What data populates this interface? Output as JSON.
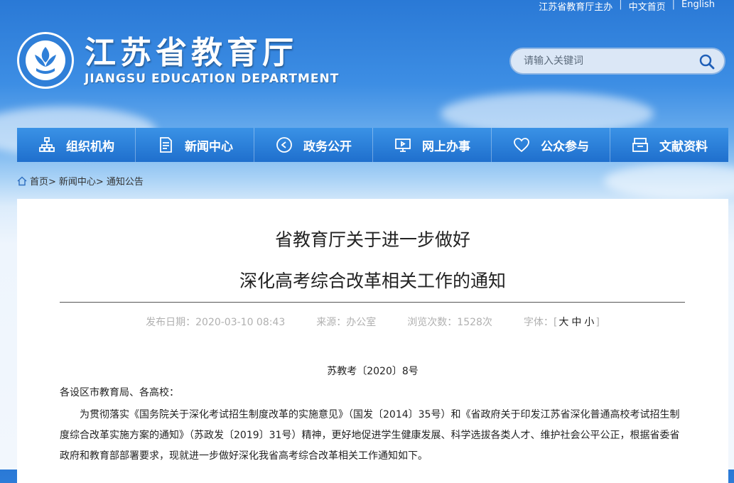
{
  "top_links": {
    "host": "江苏省教育厅主办",
    "home": "中文首页",
    "english": "English"
  },
  "site": {
    "title_cn": "江苏省教育厅",
    "title_en": "JIANGSU EDUCATION DEPARTMENT"
  },
  "search": {
    "placeholder": "请输入关键词"
  },
  "nav": [
    {
      "label": "组织机构",
      "icon": "org-chart-icon"
    },
    {
      "label": "新闻中心",
      "icon": "document-icon"
    },
    {
      "label": "政务公开",
      "icon": "play-circle-icon"
    },
    {
      "label": "网上办事",
      "icon": "monitor-icon"
    },
    {
      "label": "公众参与",
      "icon": "heart-icon"
    },
    {
      "label": "文献资料",
      "icon": "archive-icon"
    }
  ],
  "breadcrumb": {
    "home": "首页>",
    "news": "新闻中心>",
    "current": "通知公告"
  },
  "article": {
    "title_line1": "省教育厅关于进一步做好",
    "title_line2": "深化高考综合改革相关工作的通知",
    "publish_date": "发布日期：2020-03-10 08:43",
    "source": "来源：办公室",
    "views": "浏览次数：1528次",
    "font_label": "字体：",
    "font_sizes": {
      "large": "大",
      "medium": "中",
      "small": "小"
    },
    "doc_number": "苏教考〔2020〕8号",
    "salutation": "各设区市教育局、各高校：",
    "body": "为贯彻落实《国务院关于深化考试招生制度改革的实施意见》（国发〔2014〕35号）和《省政府关于印发江苏省深化普通高校考试招生制度综合改革实施方案的通知》（苏政发〔2019〕31号）精神，更好地促进学生健康发展、科学选拔各类人才、维护社会公平公正，根据省委省政府和教育部部署要求，现就进一步做好深化我省高考综合改革相关工作通知如下。"
  },
  "colors": {
    "nav_blue": "#1f6fcd",
    "sky_top": "#2a79d6"
  }
}
